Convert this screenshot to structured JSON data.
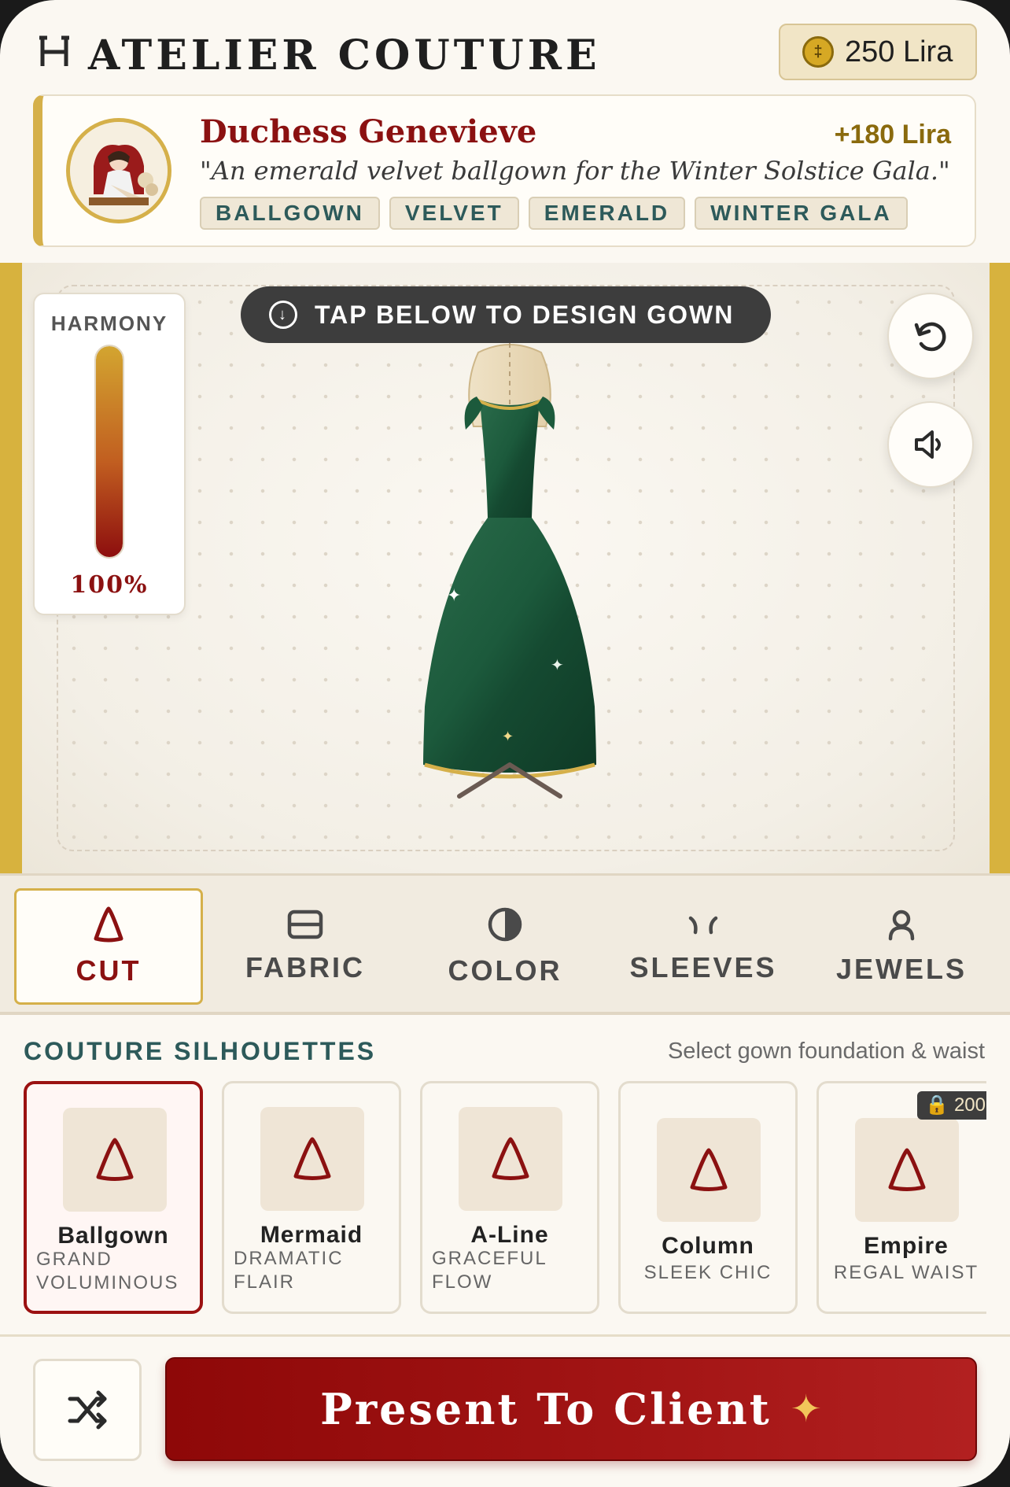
{
  "app": {
    "title": "ATELIER COUTURE",
    "currency": "250 Lira",
    "coin_symbol": "‡"
  },
  "client": {
    "name": "Duchess Genevieve",
    "reward": "+180 Lira",
    "quote": "\"An emerald velvet ballgown for the Winter Solstice Gala.\"",
    "tags": [
      "BALLGOWN",
      "VELVET",
      "EMERALD",
      "WINTER GALA"
    ]
  },
  "canvas": {
    "hint": "TAP BELOW TO DESIGN GOWN",
    "harmony_label": "HARMONY",
    "harmony_value": "100%",
    "harmony_fraction": 1.0,
    "gown_color": "#1c5a3c",
    "trim_color": "#d5b04a",
    "reset_icon": "reset-icon",
    "sound_icon": "speaker-icon"
  },
  "tabs": [
    {
      "label": "CUT",
      "icon": "triangle-icon",
      "active": true
    },
    {
      "label": "FABRIC",
      "icon": "fabric-icon",
      "active": false
    },
    {
      "label": "COLOR",
      "icon": "color-icon",
      "active": false
    },
    {
      "label": "SLEEVES",
      "icon": "sleeves-icon",
      "active": false
    },
    {
      "label": "JEWELS",
      "icon": "jewels-icon",
      "active": false
    }
  ],
  "section": {
    "title": "COUTURE SILHOUETTES",
    "hint": "Select gown foundation & waist"
  },
  "options": [
    {
      "name": "Ballgown",
      "sub": "GRAND VOLUMINOUS",
      "sub_lines": [
        "GRAND",
        "VOLUMINOUS"
      ],
      "selected": true
    },
    {
      "name": "Mermaid",
      "sub": "DRAMATIC FLAIR",
      "sub_lines": [
        "DRAMATIC",
        "FLAIR"
      ],
      "selected": false
    },
    {
      "name": "A-Line",
      "sub": "GRACEFUL FLOW",
      "sub_lines": [
        "GRACEFUL",
        "FLOW"
      ],
      "selected": false
    },
    {
      "name": "Column",
      "sub": "SLEEK CHIC",
      "sub_lines": [
        "SLEEK CHIC"
      ],
      "selected": false
    },
    {
      "name": "Empire",
      "sub": "REGAL WAIST",
      "sub_lines": [
        "REGAL WAIST"
      ],
      "selected": false,
      "locked": true,
      "price": "🔒 200"
    }
  ],
  "footer": {
    "present_label": "Present To Client",
    "present_icon": "sparkle-icon",
    "shuffle_icon": "shuffle-icon"
  },
  "colors": {
    "accent": "#8b1111",
    "gold": "#d5b04a",
    "teal": "#2d5a5a"
  }
}
